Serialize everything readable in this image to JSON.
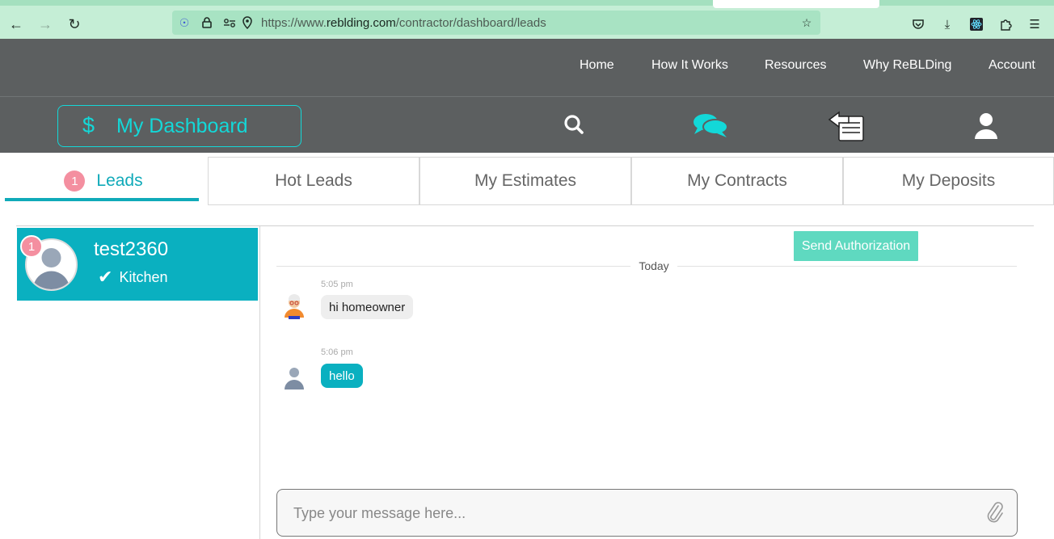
{
  "browser": {
    "url_scheme": "https://www.",
    "url_host": "reblding.com",
    "url_path": "/contractor/dashboard/leads"
  },
  "top_nav": {
    "items": [
      "Home",
      "How It Works",
      "Resources",
      "Why ReBLDing",
      "Account"
    ]
  },
  "dashboard": {
    "dollar": "$",
    "label": "My Dashboard"
  },
  "tabs": [
    {
      "label": "Leads",
      "badge": "1",
      "active": true
    },
    {
      "label": "Hot Leads"
    },
    {
      "label": "My Estimates"
    },
    {
      "label": "My Contracts"
    },
    {
      "label": "My Deposits"
    }
  ],
  "lead": {
    "badge": "1",
    "name": "test2360",
    "tag": "Kitchen"
  },
  "chat": {
    "send_authorization": "Send Authorization",
    "date_divider": "Today",
    "messages": [
      {
        "time": "5:05 pm",
        "text": "hi homeowner",
        "direction": "in"
      },
      {
        "time": "5:06 pm",
        "text": "hello",
        "direction": "out"
      }
    ],
    "placeholder": "Type your message here..."
  },
  "colors": {
    "accent": "#0ab0c0",
    "header_bg": "#5c5f60",
    "badge": "#f48fa0",
    "send_button": "#5fd9c0"
  }
}
